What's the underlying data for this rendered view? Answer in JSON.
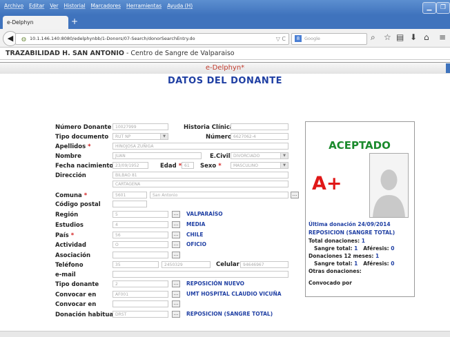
{
  "browser": {
    "menu": [
      "Archivo",
      "Editar",
      "Ver",
      "Historial",
      "Marcadores",
      "Herramientas",
      "Ayuda (H)"
    ],
    "tab_title": "e-Delphyn",
    "new_tab": "+",
    "url": "10.1.146.140:8080/edelphynbb/1-Donors/07-Search/donorSearchEntry.do",
    "url_controls": "▽ C",
    "search_engine": "8",
    "search_placeholder": "Google"
  },
  "app": {
    "title_bold": "TRAZABILIDAD H. SAN ANTONIO",
    "title_rest": " - Centro de Sangre de Valparaiso",
    "product": "e-Delphyn*",
    "heading": "DATOS DEL DONANTE"
  },
  "form": {
    "numero_donante": {
      "label": "Número Donante",
      "value": "10027999"
    },
    "historia_clinica": {
      "label": "Historia Clínica",
      "value": ""
    },
    "tipo_documento": {
      "label": "Tipo documento",
      "value": "RUT NP"
    },
    "numero": {
      "label": "Número",
      "value": "6627062-4"
    },
    "apellidos": {
      "label": "Apellidos",
      "value": "HINOJOSA ZUÑIGA"
    },
    "nombre": {
      "label": "Nombre",
      "value": "JUAN"
    },
    "ecivil": {
      "label": "E.Civil",
      "value": "DIVORCIADO"
    },
    "fecha_nacimiento": {
      "label": "Fecha nacimiento",
      "value": "23/09/1952"
    },
    "edad": {
      "label": "Edad",
      "value": "61"
    },
    "sexo": {
      "label": "Sexo",
      "value": "MASCULINO"
    },
    "direccion": {
      "label": "Dirección",
      "value1": "BILBAO 81",
      "value2": "CARTAGENA"
    },
    "comuna": {
      "label": "Comuna",
      "code": "5601",
      "value": "San Antonio"
    },
    "codigo_postal": {
      "label": "Código postal",
      "value": ""
    },
    "region": {
      "label": "Región",
      "code": "5",
      "value": "VALPARAÍSO"
    },
    "estudios": {
      "label": "Estudios",
      "code": "4",
      "value": "MEDIA"
    },
    "pais": {
      "label": "País",
      "code": "56",
      "value": "CHILE"
    },
    "actividad": {
      "label": "Actividad",
      "code": "O",
      "value": "OFICIO"
    },
    "asociacion": {
      "label": "Asociación",
      "code": "",
      "value": ""
    },
    "telefono": {
      "label": "Teléfono",
      "code": "35",
      "value": "2450329"
    },
    "celular": {
      "label": "Celular",
      "value": "94646967"
    },
    "email": {
      "label": "e-mail",
      "value": ""
    },
    "tipo_donante": {
      "label": "Tipo donante",
      "code": "2",
      "value": "REPOSICIÓN NUEVO"
    },
    "convocar_en_1": {
      "label": "Convocar en",
      "code": "AF001",
      "value": "UMT HOSPITAL CLAUDIO VICUÑA"
    },
    "convocar_en_2": {
      "label": "Convocar en",
      "code": "",
      "value": ""
    },
    "donacion_habitual": {
      "label": "Donación habitual",
      "code": "DRST",
      "value": "REPOSICION (SANGRE TOTAL)"
    },
    "required_mark": "*",
    "dots": "..."
  },
  "panel": {
    "status": "ACEPTADO",
    "blood_type": "A+",
    "ultima_donacion": "Última donación 24/09/2014",
    "ultima_tipo": "REPOSICION (SANGRE TOTAL)",
    "total_label": "Total donaciones:",
    "total_value": "1",
    "sangre_total_label": "Sangre total:",
    "sangre_total_value": "1",
    "aferesis_label": "Aféresis:",
    "aferesis_value": "0",
    "d12_label": "Donaciones 12 meses:",
    "d12_value": "1",
    "d12_sangre_value": "1",
    "d12_aferesis_value": "0",
    "otras_label": "Otras donaciones:",
    "convocado_label": "Convocado por"
  },
  "colors": {
    "accent_blue": "#1f3fa3",
    "accepted_green": "#1a8a2c",
    "blood_red": "#e01818"
  }
}
